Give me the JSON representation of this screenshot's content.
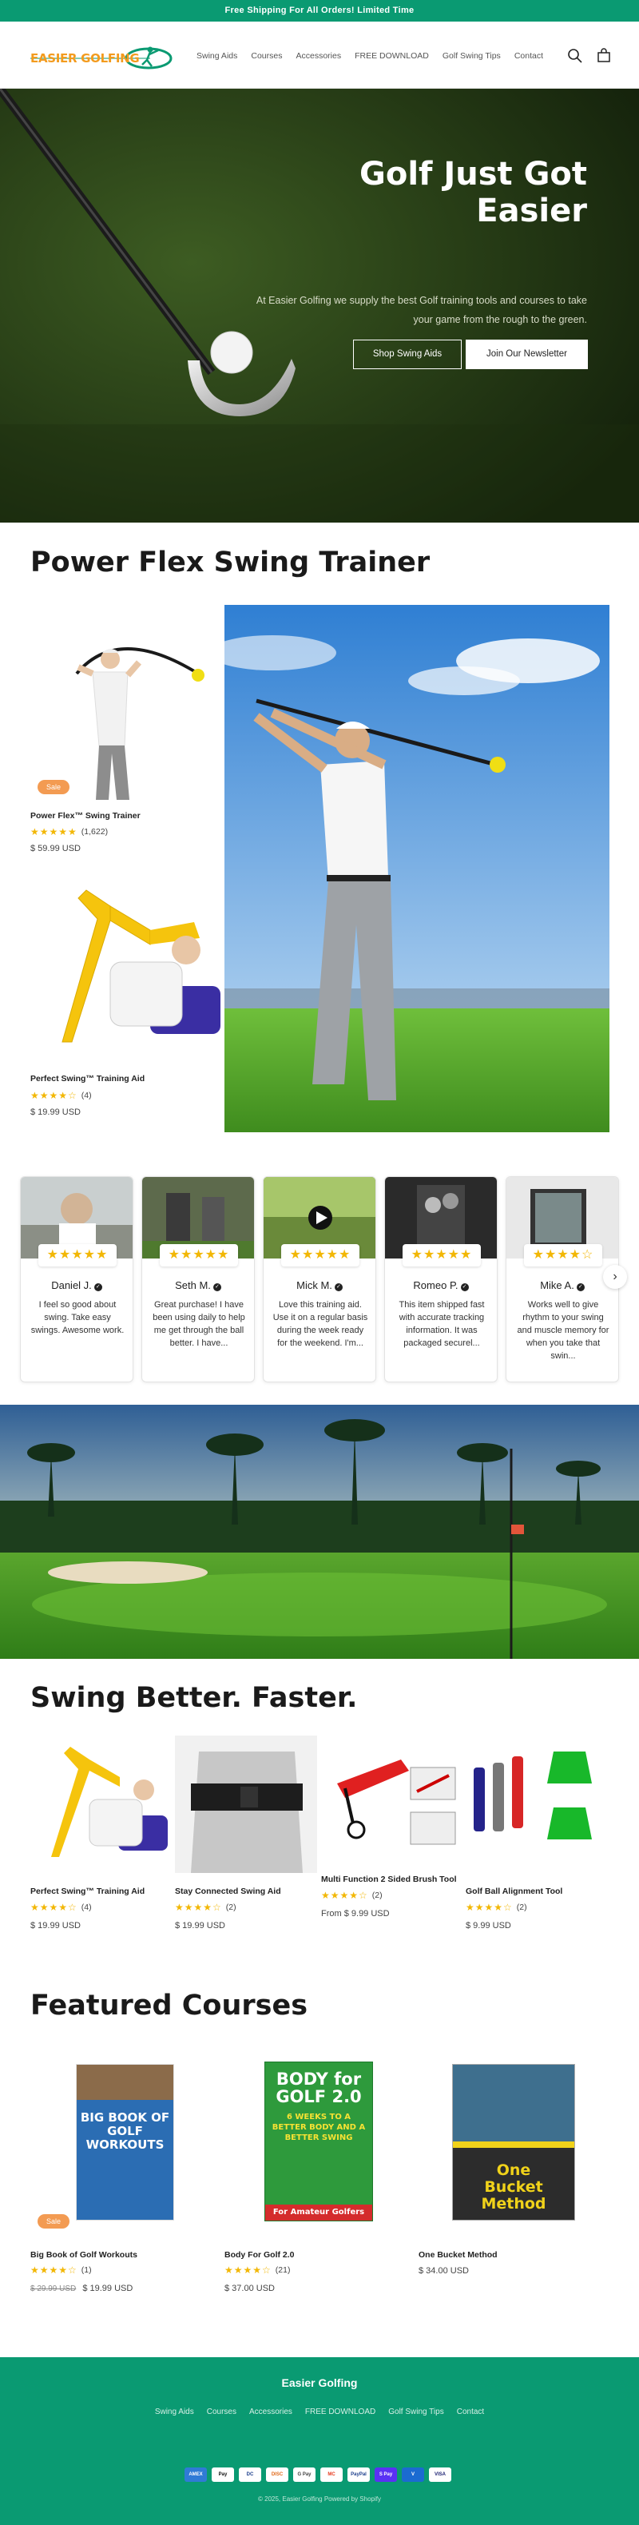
{
  "announcement": "Free Shipping For All Orders! Limited Time",
  "brand": {
    "logo_text": "EASIER GOLFING",
    "accent": "#0a9a72"
  },
  "nav": {
    "items": [
      "Swing Aids",
      "Courses",
      "Accessories",
      "FREE DOWNLOAD",
      "Golf Swing Tips",
      "Contact"
    ]
  },
  "header_icons": [
    "search-icon",
    "cart-icon"
  ],
  "hero": {
    "title": "Golf Just Got Easier",
    "subtitle_line1": "At Easier Golfing we supply the best Golf training tools and courses to take",
    "subtitle_line2": "your game from the rough to the green.",
    "btn_primary": "Shop Swing Aids",
    "btn_secondary": "Join Our Newsletter"
  },
  "power_flex": {
    "heading": "Power Flex Swing Trainer",
    "products": [
      {
        "name": "Power Flex™ Swing Trainer",
        "badge": "Sale",
        "stars": "★★★★★",
        "reviews": "(1,622)",
        "price": "$ 59.99 USD"
      },
      {
        "name": "Perfect Swing™ Training Aid",
        "stars": "★★★★☆",
        "reviews": "(4)",
        "price": "$ 19.99 USD"
      }
    ]
  },
  "reviews": [
    {
      "stars": "★★★★★",
      "name": "Daniel J.",
      "text": "I feel so good about swing. Take easy swings. Awesome work."
    },
    {
      "stars": "★★★★★",
      "name": "Seth M.",
      "text": "Great purchase! I have been using daily to help me get through the ball better. I have..."
    },
    {
      "stars": "★★★★★",
      "name": "Mick M.",
      "text": "Love this training aid. Use it on a regular basis during the week ready for the weekend. I'm..."
    },
    {
      "stars": "★★★★★",
      "name": "Romeo P.",
      "text": "This item shipped fast with accurate tracking information. It was packaged securel..."
    },
    {
      "stars": "★★★★☆",
      "name": "Mike A.",
      "text": "Works well to give rhythm to your swing and muscle memory for when you take that swin..."
    }
  ],
  "swing_better": {
    "heading": "Swing Better. Faster.",
    "products": [
      {
        "name": "Perfect Swing™ Training Aid",
        "stars": "★★★★☆",
        "reviews": "(4)",
        "price": "$ 19.99 USD"
      },
      {
        "name": "Stay Connected Swing Aid",
        "stars": "★★★★☆",
        "reviews": "(2)",
        "price": "$ 19.99 USD"
      },
      {
        "name": "Multi Function 2 Sided Brush Tool",
        "stars": "★★★★☆",
        "reviews": "(2)",
        "price": "From $ 9.99 USD"
      },
      {
        "name": "Golf Ball Alignment Tool",
        "stars": "★★★★☆",
        "reviews": "(2)",
        "price": "$ 9.99 USD"
      }
    ]
  },
  "courses": {
    "heading": "Featured Courses",
    "items": [
      {
        "name": "Big Book of Golf Workouts",
        "badge": "Sale",
        "cover": "BIG BOOK OF GOLF WORKOUTS",
        "stars": "★★★★☆",
        "reviews": "(1)",
        "old_price": "$ 29.99 USD",
        "price": "$ 19.99 USD"
      },
      {
        "name": "Body For Golf 2.0",
        "cover_top": "BODY for GOLF 2.0",
        "cover_mid": "6 WEEKS TO A BETTER BODY AND A BETTER SWING",
        "cover_bottom": "For Amateur Golfers",
        "stars": "★★★★☆",
        "reviews": "(21)",
        "price": "$ 37.00 USD"
      },
      {
        "name": "One Bucket Method",
        "cover": "One Bucket Method",
        "price": "$ 34.00 USD"
      }
    ]
  },
  "footer": {
    "brand": "Easier Golfing",
    "links": [
      "Swing Aids",
      "Courses",
      "Accessories",
      "FREE DOWNLOAD",
      "Golf Swing Tips",
      "Contact"
    ],
    "payments": [
      "AMEX",
      "Pay",
      "DC",
      "DISC",
      "G Pay",
      "MC",
      "PayPal",
      "S Pay",
      "V",
      "VISA"
    ],
    "copyright": "© 2025, Easier Golfing Powered by Shopify"
  }
}
